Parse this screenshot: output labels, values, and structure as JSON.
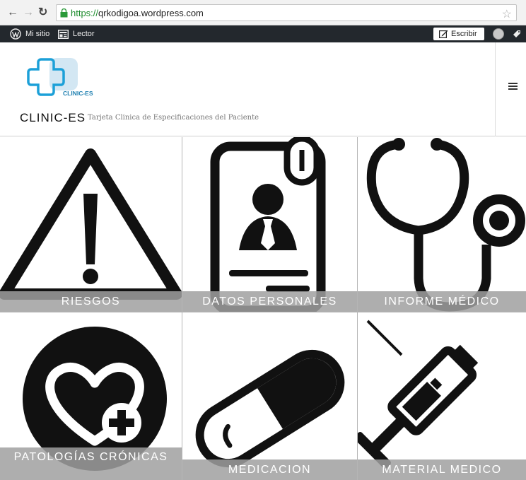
{
  "browser": {
    "url_scheme": "https://",
    "url_host": "qrkodigoa.wordpress.com"
  },
  "admin_bar": {
    "my_site": "Mi sitio",
    "reader": "Lector",
    "write": "Escribir"
  },
  "site": {
    "logo_text": "CLINIC-ES",
    "title": "CLINIC-ES",
    "description": "Tarjeta Clinica de Especificaciones del Paciente"
  },
  "tiles": [
    {
      "label": "RIESGOS",
      "icon": "warning-icon"
    },
    {
      "label": "DATOS PERSONALES",
      "icon": "id-card-icon"
    },
    {
      "label": "INFORME MÉDICO",
      "icon": "stethoscope-icon"
    },
    {
      "label": "PATOLOGÍAS CRÓNICAS",
      "icon": "heart-plus-icon"
    },
    {
      "label": "MEDICACION",
      "icon": "pill-icon"
    },
    {
      "label": "MATERIAL MEDICO",
      "icon": "syringe-icon"
    }
  ],
  "colors": {
    "admin_bar": "#23282d",
    "logo_blue": "#1ca0d8",
    "label_overlay": "#a0a0a0"
  }
}
